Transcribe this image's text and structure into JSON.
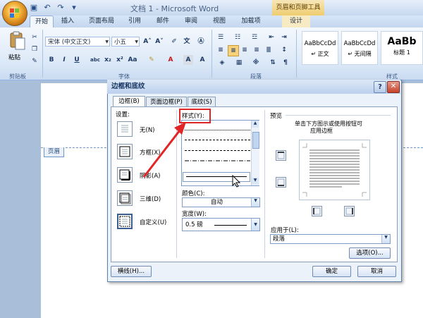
{
  "titlebar": {
    "title": "文档 1 - Microsoft Word",
    "context_tab_group": "页眉和页脚工具"
  },
  "tabs": [
    "开始",
    "插入",
    "页面布局",
    "引用",
    "邮件",
    "审阅",
    "视图",
    "加载项",
    "设计"
  ],
  "ribbon": {
    "clipboard": {
      "paste_label": "粘贴",
      "group_label": "剪贴板"
    },
    "font": {
      "font_name": "宋体 (中文正文)",
      "font_size": "小五",
      "group_label": "字体"
    },
    "paragraph": {
      "group_label": "段落"
    },
    "styles": {
      "group_label": "样式",
      "items": [
        {
          "preview": "AaBbCcDd",
          "name": "↵ 正文"
        },
        {
          "preview": "AaBbCcDd",
          "name": "↵ 无间隔"
        },
        {
          "preview": "AaBb",
          "name": "标题 1"
        }
      ]
    }
  },
  "document": {
    "header_tag": "页眉"
  },
  "dialog": {
    "title": "边框和底纹",
    "tabs": [
      "边框(B)",
      "页面边框(P)",
      "底纹(S)"
    ],
    "settings_label": "设置:",
    "settings": [
      "无(N)",
      "方框(X)",
      "阴影(A)",
      "三维(D)",
      "自定义(U)"
    ],
    "style_label": "样式(Y):",
    "color_label": "颜色(C):",
    "color_value": "自动",
    "width_label": "宽度(W):",
    "width_value": "0.5 磅",
    "preview_label": "预览",
    "preview_hint_1": "单击下方图示或使用按钮可",
    "preview_hint_2": "应用边框",
    "apply_label": "应用于(L):",
    "apply_value": "段落",
    "options_button": "选项(O)...",
    "hline_button": "横线(H)...",
    "ok_button": "确定",
    "cancel_button": "取消"
  },
  "colors": {
    "highlight": "#e02626",
    "accent": "#3b5f92"
  }
}
